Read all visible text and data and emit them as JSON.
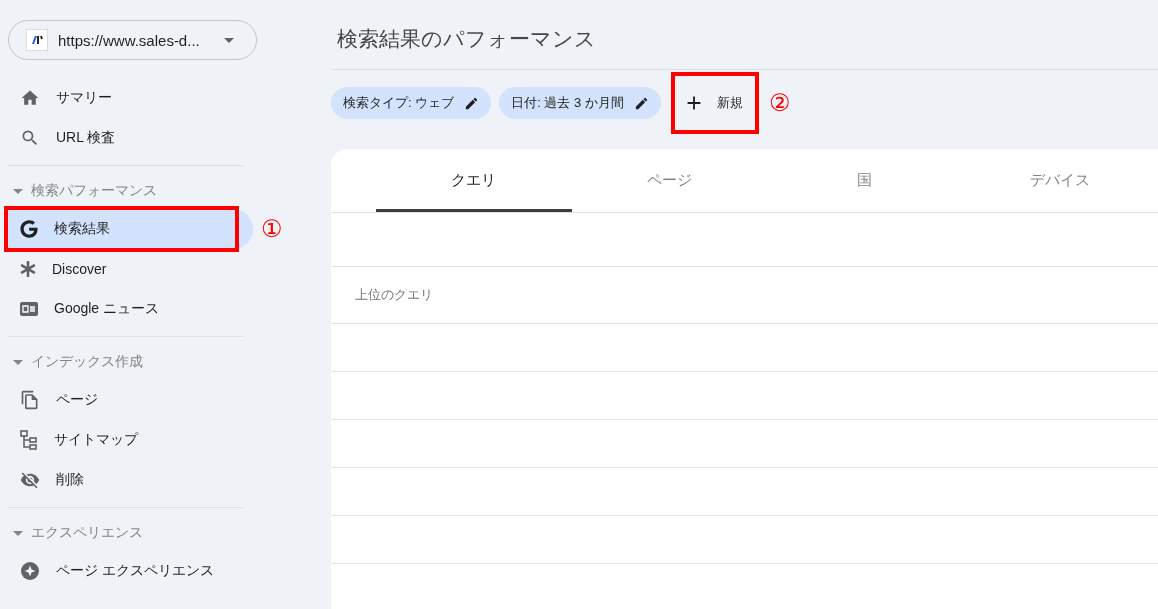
{
  "property": {
    "url": "https://www.sales-d..."
  },
  "sections": [
    {
      "items": [
        {
          "label": "サマリー",
          "selected": false
        },
        {
          "label": "URL 検査",
          "selected": false
        }
      ]
    },
    {
      "title": "検索パフォーマンス",
      "expanded": true,
      "items": [
        {
          "label": "検索結果",
          "selected": true,
          "annotation": "①"
        },
        {
          "label": "Discover",
          "selected": false
        },
        {
          "label": "Google ニュース",
          "selected": false
        }
      ]
    },
    {
      "title": "インデックス作成",
      "expanded": true,
      "items": [
        {
          "label": "ページ",
          "selected": false
        },
        {
          "label": "サイトマップ",
          "selected": false
        },
        {
          "label": "削除",
          "selected": false
        }
      ]
    },
    {
      "title": "エクスペリエンス",
      "expanded": true,
      "items": [
        {
          "label": "ページ エクスペリエンス",
          "selected": false
        }
      ]
    }
  ],
  "page_title": "検索結果のパフォーマンス",
  "filters": [
    {
      "label": "検索タイプ: ウェブ"
    },
    {
      "label": "日付: 過去 3 か月間"
    }
  ],
  "new_button": {
    "label": "新規",
    "annotation": "②"
  },
  "tabs": [
    {
      "label": "クエリ",
      "selected": true
    },
    {
      "label": "ページ",
      "selected": false
    },
    {
      "label": "国",
      "selected": false
    },
    {
      "label": "デバイス",
      "selected": false
    }
  ],
  "table": {
    "heading": "上位のクエリ"
  }
}
